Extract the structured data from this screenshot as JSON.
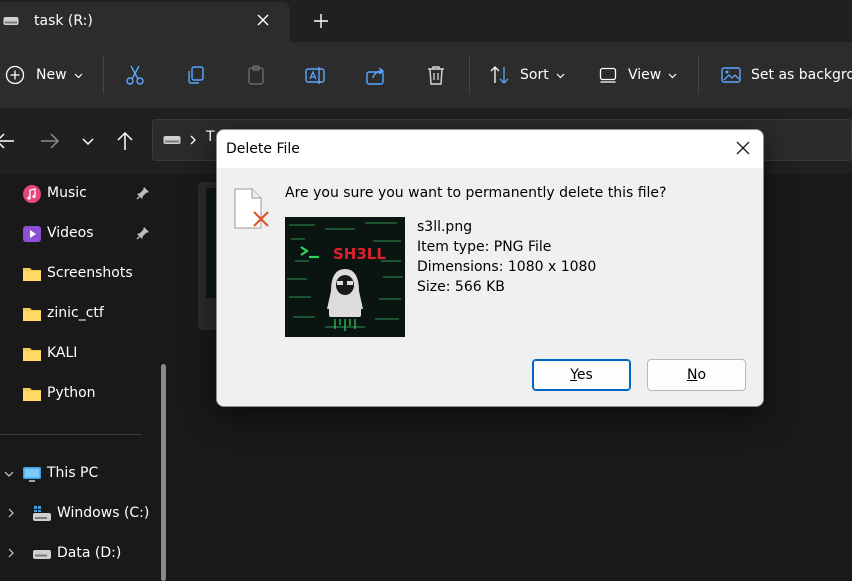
{
  "tab": {
    "title": "task (R:)"
  },
  "toolbar": {
    "new_label": "New",
    "sort_label": "Sort",
    "view_label": "View",
    "background_label": "Set as backgrou"
  },
  "address": {
    "first_char": "T"
  },
  "sidebar": {
    "items": [
      {
        "label": "Music",
        "icon": "music-icon",
        "pinned": true
      },
      {
        "label": "Videos",
        "icon": "video-icon",
        "pinned": true
      },
      {
        "label": "Screenshots",
        "icon": "folder-icon"
      },
      {
        "label": "zinic_ctf",
        "icon": "folder-icon"
      },
      {
        "label": "KALI",
        "icon": "folder-icon"
      },
      {
        "label": "Python",
        "icon": "folder-icon"
      }
    ],
    "drives": [
      {
        "label": "This PC",
        "icon": "monitor-icon"
      },
      {
        "label": "Windows (C:)",
        "icon": "windows-drive-icon"
      },
      {
        "label": "Data (D:)",
        "icon": "drive-icon"
      }
    ]
  },
  "dialog": {
    "title": "Delete File",
    "question": "Are you sure you want to permanently delete this file?",
    "file": {
      "name": "s3ll.png",
      "type_line": "Item type: PNG File",
      "dimensions_line": "Dimensions: 1080 x 1080",
      "size_line": "Size: 566 KB"
    },
    "preview_text": "SH3LL",
    "yes_mnemonic": "Y",
    "yes_rest": "es",
    "no_mnemonic": "N",
    "no_rest": "o"
  },
  "colors": {
    "accent": "#0067c0",
    "folder": "#f4c94f",
    "music": "#e8457a",
    "video": "#8c4fd6",
    "delete_x": "#d9532c",
    "preview_red": "#e0202e",
    "preview_green": "#2fd35a"
  }
}
